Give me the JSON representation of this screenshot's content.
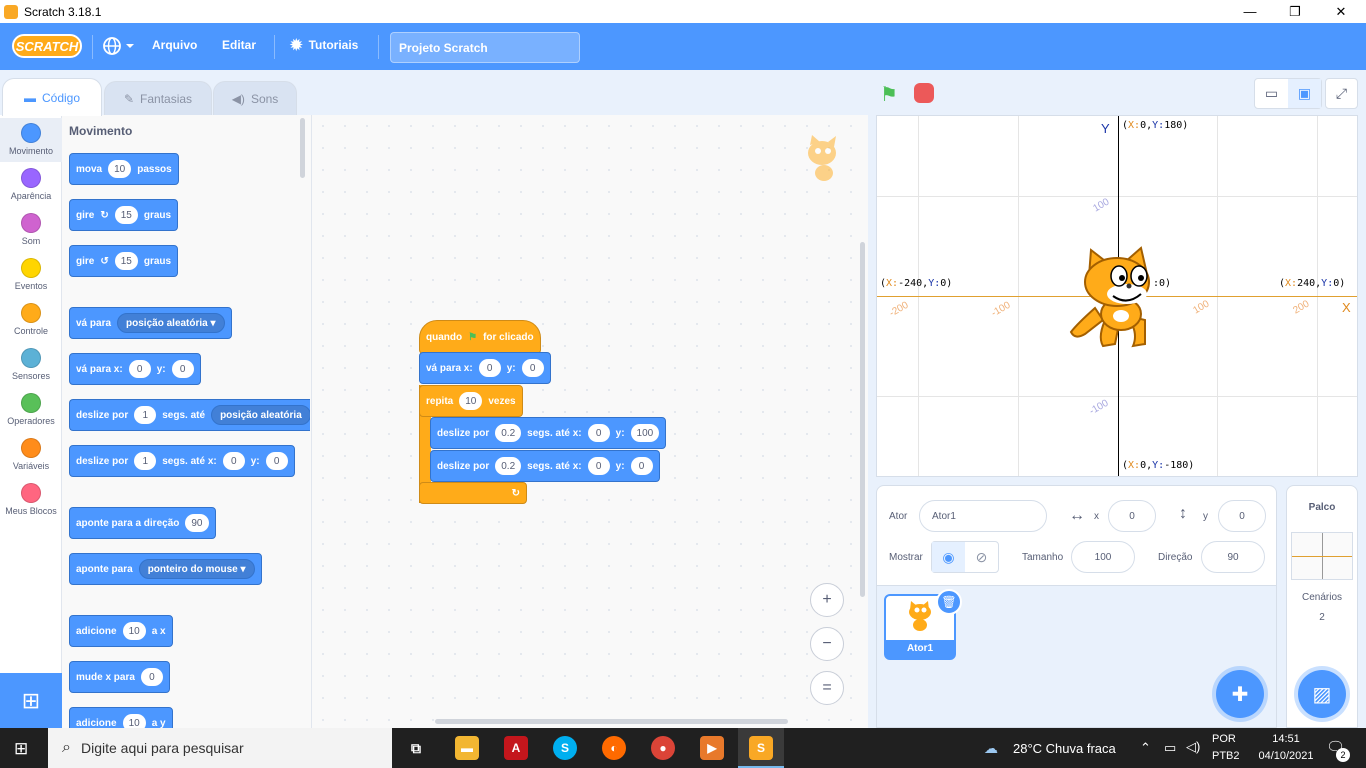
{
  "window": {
    "title": "Scratch 3.18.1",
    "minimize": "—",
    "maximize": "❐",
    "close": "✕"
  },
  "menu": {
    "logo": "SCRATCH",
    "language_icon": "globe-icon",
    "file": "Arquivo",
    "edit": "Editar",
    "tutorials": "Tutoriais",
    "project_name": "Projeto Scratch"
  },
  "tabs": {
    "code": "Código",
    "costumes": "Fantasias",
    "sounds": "Sons"
  },
  "categories": [
    {
      "label": "Movimento",
      "color": "#4c97ff"
    },
    {
      "label": "Aparência",
      "color": "#9966ff"
    },
    {
      "label": "Som",
      "color": "#cf63cf"
    },
    {
      "label": "Eventos",
      "color": "#ffd500"
    },
    {
      "label": "Controle",
      "color": "#ffab19"
    },
    {
      "label": "Sensores",
      "color": "#5cb1d6"
    },
    {
      "label": "Operadores",
      "color": "#59c059"
    },
    {
      "label": "Variáveis",
      "color": "#ff8c1a"
    },
    {
      "label": "Meus Blocos",
      "color": "#ff6680"
    }
  ],
  "palette": {
    "heading": "Movimento",
    "b_move": {
      "a": "mova",
      "n": "10",
      "b": "passos"
    },
    "b_turn_right": {
      "a": "gire",
      "n": "15",
      "b": "graus"
    },
    "b_turn_left": {
      "a": "gire",
      "n": "15",
      "b": "graus"
    },
    "b_goto": {
      "a": "vá para",
      "d": "posição aleatória"
    },
    "b_gotoxy": {
      "a": "vá para x:",
      "x": "0",
      "ylbl": "y:",
      "y": "0"
    },
    "b_glide": {
      "a": "deslize por",
      "n": "1",
      "b": "segs. até",
      "d": "posição aleatória"
    },
    "b_glidexy": {
      "a": "deslize por",
      "n": "1",
      "b": "segs. até x:",
      "x": "0",
      "ylbl": "y:",
      "y": "0"
    },
    "b_point": {
      "a": "aponte  para a direção",
      "n": "90"
    },
    "b_pointto": {
      "a": "aponte para",
      "d": "ponteiro do mouse"
    },
    "b_changex": {
      "a": "adicione",
      "n": "10",
      "b": "a x"
    },
    "b_setx": {
      "a": "mude x para",
      "n": "0"
    },
    "b_changey": {
      "a": "adicione",
      "n": "10",
      "b": "a y"
    }
  },
  "script": {
    "hat": {
      "a": "quando",
      "b": "for clicado"
    },
    "gotoxy": {
      "a": "vá para x:",
      "x": "0",
      "ylbl": "y:",
      "y": "0"
    },
    "repeat": {
      "a": "repita",
      "n": "10",
      "b": "vezes"
    },
    "glide1": {
      "a": "deslize por",
      "n": "0.2",
      "b": "segs. até x:",
      "x": "0",
      "ylbl": "y:",
      "y": "100"
    },
    "glide2": {
      "a": "deslize por",
      "n": "0.2",
      "b": "segs. até x:",
      "x": "0",
      "ylbl": "y:",
      "y": "0"
    },
    "loop_arrow": "↻"
  },
  "zoom": {
    "in": "+",
    "out": "−",
    "reset": "="
  },
  "stage": {
    "y_axis": "Y",
    "x_axis": "X",
    "top": {
      "x": "0",
      "y": "180"
    },
    "bottom": {
      "x": "0",
      "y": "-180"
    },
    "left": {
      "x": "-240",
      "y": "0"
    },
    "right": {
      "x": "240",
      "y": "0"
    },
    "center_tail": ":0)",
    "ticks_x": [
      "-200",
      "-100",
      "100",
      "200"
    ],
    "ticks_y": [
      "100",
      "-100"
    ]
  },
  "sprite": {
    "label": "Ator",
    "name": "Ator1",
    "x_label": "x",
    "x": "0",
    "y_label": "y",
    "y": "0",
    "show": "Mostrar",
    "size_label": "Tamanho",
    "size": "100",
    "dir_label": "Direção",
    "dir": "90",
    "thumb_name": "Ator1"
  },
  "stage_pane": {
    "title": "Palco",
    "backdrops_label": "Cenários",
    "backdrops": "2"
  },
  "taskbar": {
    "search": "Digite aqui para pesquisar",
    "weather": "28°C  Chuva fraca",
    "lang1": "POR",
    "lang2": "PTB2",
    "time": "14:51",
    "date": "04/10/2021",
    "notif": "2"
  }
}
